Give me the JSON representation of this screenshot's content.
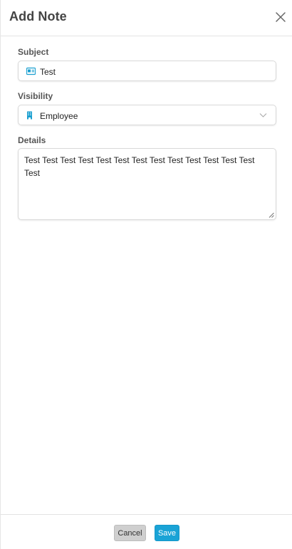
{
  "header": {
    "title": "Add Note",
    "close_icon": "close-icon"
  },
  "form": {
    "subject": {
      "label": "Subject",
      "value": "Test",
      "icon": "id-card-icon"
    },
    "visibility": {
      "label": "Visibility",
      "selected": "Employee",
      "icon": "building-icon",
      "dropdown_icon": "chevron-down-icon"
    },
    "details": {
      "label": "Details",
      "value": "Test Test Test Test Test Test Test Test Test Test Test Test Test Test"
    }
  },
  "footer": {
    "cancel_label": "Cancel",
    "save_label": "Save"
  },
  "colors": {
    "accent": "#1aa3d6",
    "cancel_bg": "#cfcfcf",
    "icon": "#1a9fd0"
  }
}
